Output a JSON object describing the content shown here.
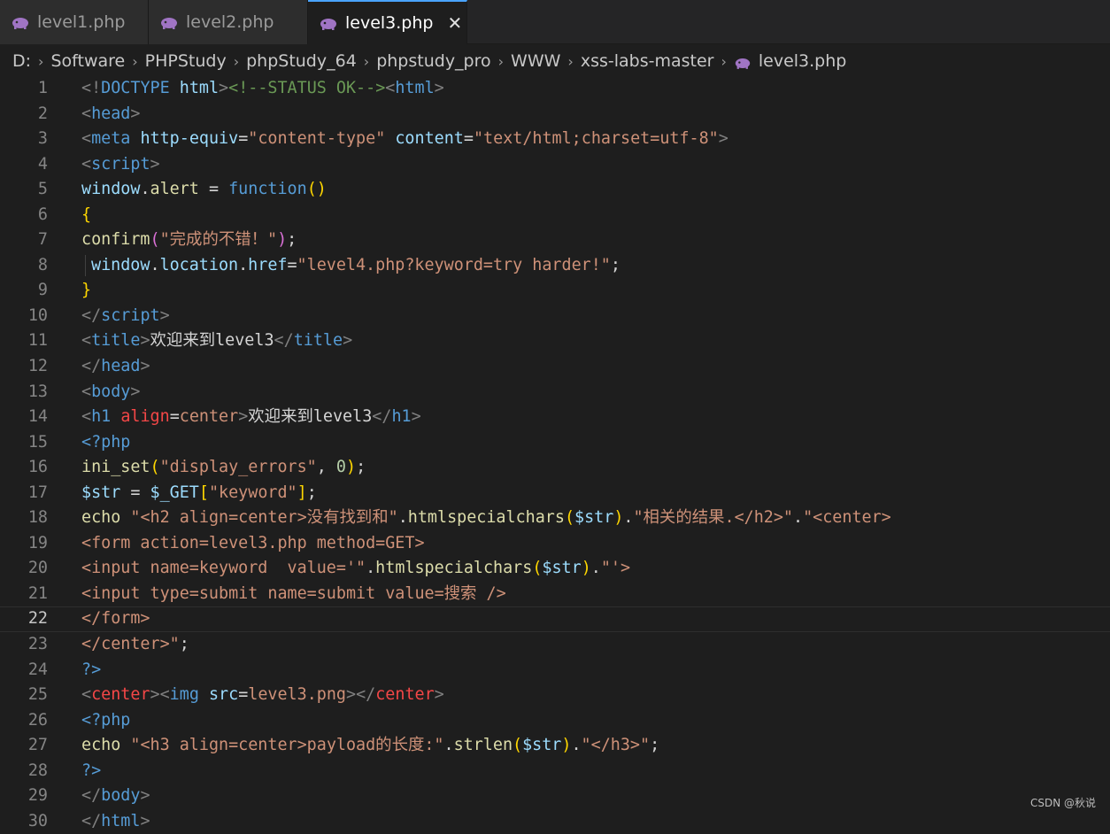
{
  "tabs": [
    {
      "label": "level1.php",
      "active": false
    },
    {
      "label": "level2.php",
      "active": false
    },
    {
      "label": "level3.php",
      "active": true
    }
  ],
  "tab_close_glyph": "✕",
  "breadcrumb": [
    "D:",
    "Software",
    "PHPStudy",
    "phpStudy_64",
    "phpstudy_pro",
    "WWW",
    "xss-labs-master",
    "level3.php"
  ],
  "current_line": 22,
  "lines": [
    {
      "n": "1",
      "indent": false,
      "tokens": [
        [
          "delim",
          "<!"
        ],
        [
          "tag",
          "DOCTYPE"
        ],
        [
          "text",
          " "
        ],
        [
          "attr",
          "html"
        ],
        [
          "delim",
          ">"
        ],
        [
          "comment",
          "<!--STATUS OK-->"
        ],
        [
          "delim",
          "<"
        ],
        [
          "tag",
          "html"
        ],
        [
          "delim",
          ">"
        ]
      ]
    },
    {
      "n": "2",
      "indent": false,
      "tokens": [
        [
          "delim",
          "<"
        ],
        [
          "tag",
          "head"
        ],
        [
          "delim",
          ">"
        ]
      ]
    },
    {
      "n": "3",
      "indent": false,
      "tokens": [
        [
          "delim",
          "<"
        ],
        [
          "tag",
          "meta"
        ],
        [
          "text",
          " "
        ],
        [
          "attr",
          "http-equiv"
        ],
        [
          "text",
          "="
        ],
        [
          "str",
          "\"content-type\""
        ],
        [
          "text",
          " "
        ],
        [
          "attr",
          "content"
        ],
        [
          "text",
          "="
        ],
        [
          "str",
          "\"text/html;charset=utf-8\""
        ],
        [
          "delim",
          ">"
        ]
      ]
    },
    {
      "n": "4",
      "indent": false,
      "tokens": [
        [
          "delim",
          "<"
        ],
        [
          "tag",
          "script"
        ],
        [
          "delim",
          ">"
        ]
      ]
    },
    {
      "n": "5",
      "indent": false,
      "tokens": [
        [
          "var",
          "window"
        ],
        [
          "op",
          "."
        ],
        [
          "func",
          "alert"
        ],
        [
          "op",
          " = "
        ],
        [
          "keyword",
          "function"
        ],
        [
          "brace1",
          "()"
        ]
      ]
    },
    {
      "n": "6",
      "indent": false,
      "tokens": [
        [
          "brace1",
          "{"
        ]
      ]
    },
    {
      "n": "7",
      "indent": false,
      "tokens": [
        [
          "func",
          "confirm"
        ],
        [
          "brace2",
          "("
        ],
        [
          "str",
          "\"完成的不错！\""
        ],
        [
          "brace2",
          ")"
        ],
        [
          "op",
          ";"
        ]
      ]
    },
    {
      "n": "8",
      "indent": true,
      "tokens": [
        [
          "var",
          "window"
        ],
        [
          "op",
          "."
        ],
        [
          "var",
          "location"
        ],
        [
          "op",
          "."
        ],
        [
          "var",
          "href"
        ],
        [
          "op",
          "="
        ],
        [
          "str",
          "\"level4.php?keyword=try harder!\""
        ],
        [
          "op",
          ";"
        ]
      ]
    },
    {
      "n": "9",
      "indent": false,
      "tokens": [
        [
          "brace1",
          "}"
        ]
      ]
    },
    {
      "n": "10",
      "indent": false,
      "tokens": [
        [
          "delim",
          "</"
        ],
        [
          "tag",
          "script"
        ],
        [
          "delim",
          ">"
        ]
      ]
    },
    {
      "n": "11",
      "indent": false,
      "tokens": [
        [
          "delim",
          "<"
        ],
        [
          "tag",
          "title"
        ],
        [
          "delim",
          ">"
        ],
        [
          "text",
          "欢迎来到level3"
        ],
        [
          "delim",
          "</"
        ],
        [
          "tag",
          "title"
        ],
        [
          "delim",
          ">"
        ]
      ]
    },
    {
      "n": "12",
      "indent": false,
      "tokens": [
        [
          "delim",
          "</"
        ],
        [
          "tag",
          "head"
        ],
        [
          "delim",
          ">"
        ]
      ]
    },
    {
      "n": "13",
      "indent": false,
      "tokens": [
        [
          "delim",
          "<"
        ],
        [
          "tag",
          "body"
        ],
        [
          "delim",
          ">"
        ]
      ]
    },
    {
      "n": "14",
      "indent": false,
      "tokens": [
        [
          "delim",
          "<"
        ],
        [
          "tag",
          "h1"
        ],
        [
          "text",
          " "
        ],
        [
          "danger",
          "align"
        ],
        [
          "text",
          "="
        ],
        [
          "str",
          "center"
        ],
        [
          "delim",
          ">"
        ],
        [
          "text",
          "欢迎来到level3"
        ],
        [
          "delim",
          "</"
        ],
        [
          "tag",
          "h1"
        ],
        [
          "delim",
          ">"
        ]
      ]
    },
    {
      "n": "15",
      "indent": false,
      "tokens": [
        [
          "keyword",
          "<?php"
        ]
      ]
    },
    {
      "n": "16",
      "indent": false,
      "tokens": [
        [
          "func",
          "ini_set"
        ],
        [
          "brace1",
          "("
        ],
        [
          "str",
          "\"display_errors\""
        ],
        [
          "op",
          ", "
        ],
        [
          "num",
          "0"
        ],
        [
          "brace1",
          ")"
        ],
        [
          "op",
          ";"
        ]
      ]
    },
    {
      "n": "17",
      "indent": false,
      "tokens": [
        [
          "var",
          "$str"
        ],
        [
          "op",
          " = "
        ],
        [
          "var",
          "$_GET"
        ],
        [
          "brace1",
          "["
        ],
        [
          "str",
          "\"keyword\""
        ],
        [
          "brace1",
          "]"
        ],
        [
          "op",
          ";"
        ]
      ]
    },
    {
      "n": "18",
      "indent": false,
      "tokens": [
        [
          "func",
          "echo"
        ],
        [
          "op",
          " "
        ],
        [
          "str",
          "\"<h2 align=center>没有找到和\""
        ],
        [
          "op",
          "."
        ],
        [
          "func",
          "htmlspecialchars"
        ],
        [
          "brace1",
          "("
        ],
        [
          "var",
          "$str"
        ],
        [
          "brace1",
          ")"
        ],
        [
          "op",
          "."
        ],
        [
          "str",
          "\"相关的结果.</h2>\""
        ],
        [
          "op",
          "."
        ],
        [
          "str",
          "\"<center>"
        ]
      ]
    },
    {
      "n": "19",
      "indent": false,
      "tokens": [
        [
          "str",
          "<form action=level3.php method=GET>"
        ]
      ]
    },
    {
      "n": "20",
      "indent": false,
      "tokens": [
        [
          "str",
          "<input name=keyword  value='\""
        ],
        [
          "op",
          "."
        ],
        [
          "func",
          "htmlspecialchars"
        ],
        [
          "brace1",
          "("
        ],
        [
          "var",
          "$str"
        ],
        [
          "brace1",
          ")"
        ],
        [
          "op",
          "."
        ],
        [
          "str",
          "\"'>"
        ]
      ]
    },
    {
      "n": "21",
      "indent": false,
      "tokens": [
        [
          "str",
          "<input type=submit name=submit value=搜索 />"
        ]
      ]
    },
    {
      "n": "22",
      "indent": false,
      "tokens": [
        [
          "str",
          "</form>"
        ]
      ]
    },
    {
      "n": "23",
      "indent": false,
      "tokens": [
        [
          "str",
          "</center>\""
        ],
        [
          "op",
          ";"
        ]
      ]
    },
    {
      "n": "24",
      "indent": false,
      "tokens": [
        [
          "keyword",
          "?>"
        ]
      ]
    },
    {
      "n": "25",
      "indent": false,
      "tokens": [
        [
          "delim",
          "<"
        ],
        [
          "center",
          "center"
        ],
        [
          "delim",
          ">"
        ],
        [
          "delim",
          "<"
        ],
        [
          "tag",
          "img"
        ],
        [
          "text",
          " "
        ],
        [
          "attr",
          "src"
        ],
        [
          "text",
          "="
        ],
        [
          "str",
          "level3.png"
        ],
        [
          "delim",
          ">"
        ],
        [
          "delim",
          "</"
        ],
        [
          "center",
          "center"
        ],
        [
          "delim",
          ">"
        ]
      ]
    },
    {
      "n": "26",
      "indent": false,
      "tokens": [
        [
          "keyword",
          "<?php"
        ]
      ]
    },
    {
      "n": "27",
      "indent": false,
      "tokens": [
        [
          "func",
          "echo"
        ],
        [
          "op",
          " "
        ],
        [
          "str",
          "\"<h3 align=center>payload的长度:\""
        ],
        [
          "op",
          "."
        ],
        [
          "func",
          "strlen"
        ],
        [
          "brace1",
          "("
        ],
        [
          "var",
          "$str"
        ],
        [
          "brace1",
          ")"
        ],
        [
          "op",
          "."
        ],
        [
          "str",
          "\"</h3>\""
        ],
        [
          "op",
          ";"
        ]
      ]
    },
    {
      "n": "28",
      "indent": false,
      "tokens": [
        [
          "keyword",
          "?>"
        ]
      ]
    },
    {
      "n": "29",
      "indent": false,
      "tokens": [
        [
          "delim",
          "</"
        ],
        [
          "tag",
          "body"
        ],
        [
          "delim",
          ">"
        ]
      ]
    },
    {
      "n": "30",
      "indent": false,
      "tokens": [
        [
          "delim",
          "</"
        ],
        [
          "tag",
          "html"
        ],
        [
          "delim",
          ">"
        ]
      ]
    }
  ],
  "watermark": "CSDN @秋说",
  "colors": {
    "accent": "#4aa3ff",
    "editor_bg": "#1e1e1e",
    "tab_bg": "#2d2d2d",
    "php_icon": "#a074c4"
  },
  "icons": {
    "tab": "php-elephant-icon",
    "close": "close-icon",
    "separator": "chevron-right-icon"
  }
}
